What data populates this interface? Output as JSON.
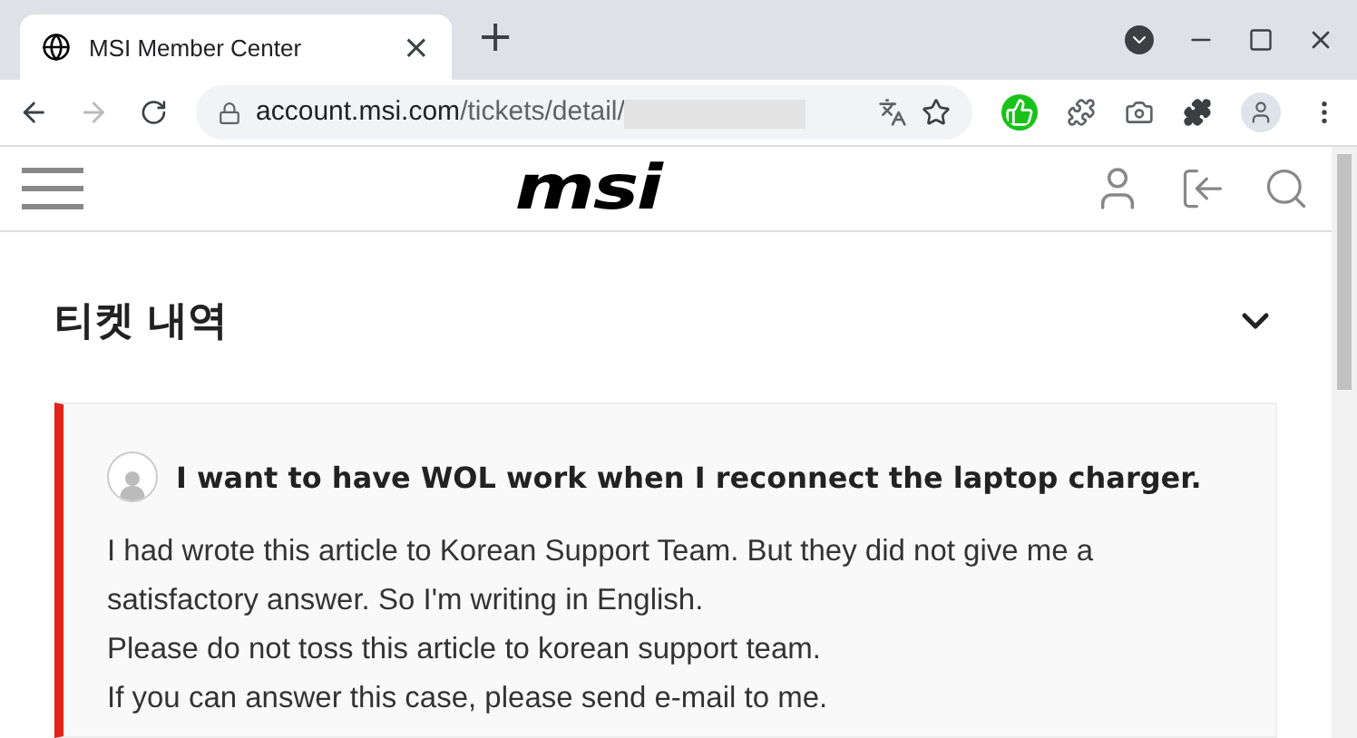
{
  "browser": {
    "tab_title": "MSI Member Center",
    "tab_close": "×",
    "new_tab": "+",
    "url_host": "account.msi.com",
    "url_path": "/tickets/detail/"
  },
  "site_header": {
    "logo": "msi"
  },
  "section": {
    "title": "티켓 내역",
    "expanded": true
  },
  "ticket": {
    "subject": "I want to have WOL work when I reconnect the laptop charger.",
    "paragraphs": [
      "I had wrote this article to Korean Support Team. But they did not give me a satisfactory answer. So I'm writing in English.",
      "Please do not toss this article to korean support team.",
      "If you can answer this case, please send e-mail to me."
    ]
  }
}
